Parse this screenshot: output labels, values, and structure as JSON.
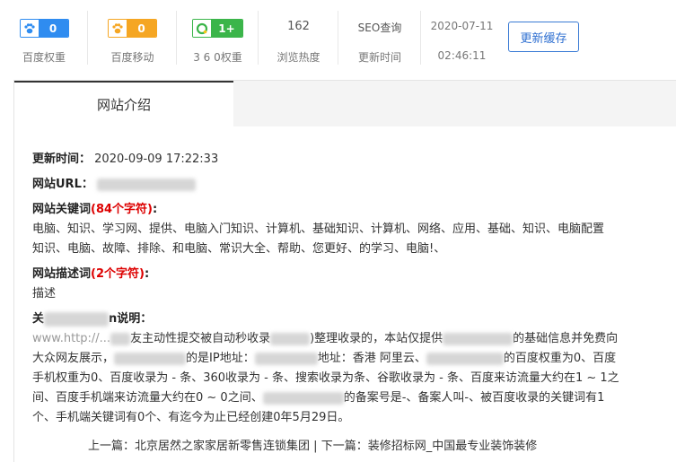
{
  "stats": {
    "baidu_weight": {
      "value": "0",
      "label": "百度权重",
      "icon": "paw-icon",
      "color": "#2f8cf0"
    },
    "baidu_mobile": {
      "value": "0",
      "label": "百度移动",
      "icon": "paw-icon",
      "color": "#f5a623"
    },
    "weight_360": {
      "value": "1+",
      "label": "3 6 0权重",
      "icon": "360-icon",
      "color": "#3bb54a"
    },
    "views": {
      "value": "162",
      "label": "浏览热度"
    },
    "seo": {
      "title": "SEO查询",
      "label": "更新时间"
    },
    "updated": {
      "date": "2020-07-11",
      "time": "02:46:11"
    },
    "refresh_button": "更新缓存"
  },
  "tabs": {
    "active": "网站介绍"
  },
  "info": {
    "update_time_label": "更新时间：",
    "update_time_value": "2020-09-09 17:22:33",
    "url_label": "网站URL：",
    "keywords_label": "网站关键词",
    "keywords_count": "(84个字符)",
    "colon": ":",
    "keywords_line1": "电脑、知识、学习网、提供、电脑入门知识、计算机、基础知识、计算机、网络、应用、基础、知识、电脑配置",
    "keywords_line2": "知识、电脑、故障、排除、和电脑、常识大全、帮助、您更好、的学习、电脑!、",
    "desc_label": "网站描述词",
    "desc_count": "(2个字符)",
    "desc_value": "描述",
    "about_label_start": "关",
    "about_label_end": "n说明：",
    "p_l1a": "www.http://...",
    "p_l1b": "友主动性提交被自动秒收录",
    "p_l1c": ")整理收录的，本站仅提供",
    "p_l1d": "的基础信息并免费向",
    "p_l2a": "大众网友展示，",
    "p_l2b": "的是IP地址：",
    "p_l2c": "地址：香港 阿里云、",
    "p_l2d": "的百度权重为0、百度",
    "p_l3": "手机权重为0、百度收录为 - 条、360收录为 - 条、搜索收录为条、谷歌收录为 - 条、百度来访流量大约在1 ~ 1之",
    "p_l4a": "间、百度手机端来访流量大约在0 ~ 0之间、",
    "p_l4b": "的备案号是-、备案人叫-、被百度收录的关键词有1",
    "p_l5": "个、手机端关键词有0个、有迄今为止已经创建0年5月29日。"
  },
  "nav": {
    "prev_label": "上一篇：",
    "prev_title": "北京居然之家家居新零售连锁集团",
    "divider": " | ",
    "next_label": "下一篇：",
    "next_title": "装修招标网_中国最专业装饰装修"
  }
}
